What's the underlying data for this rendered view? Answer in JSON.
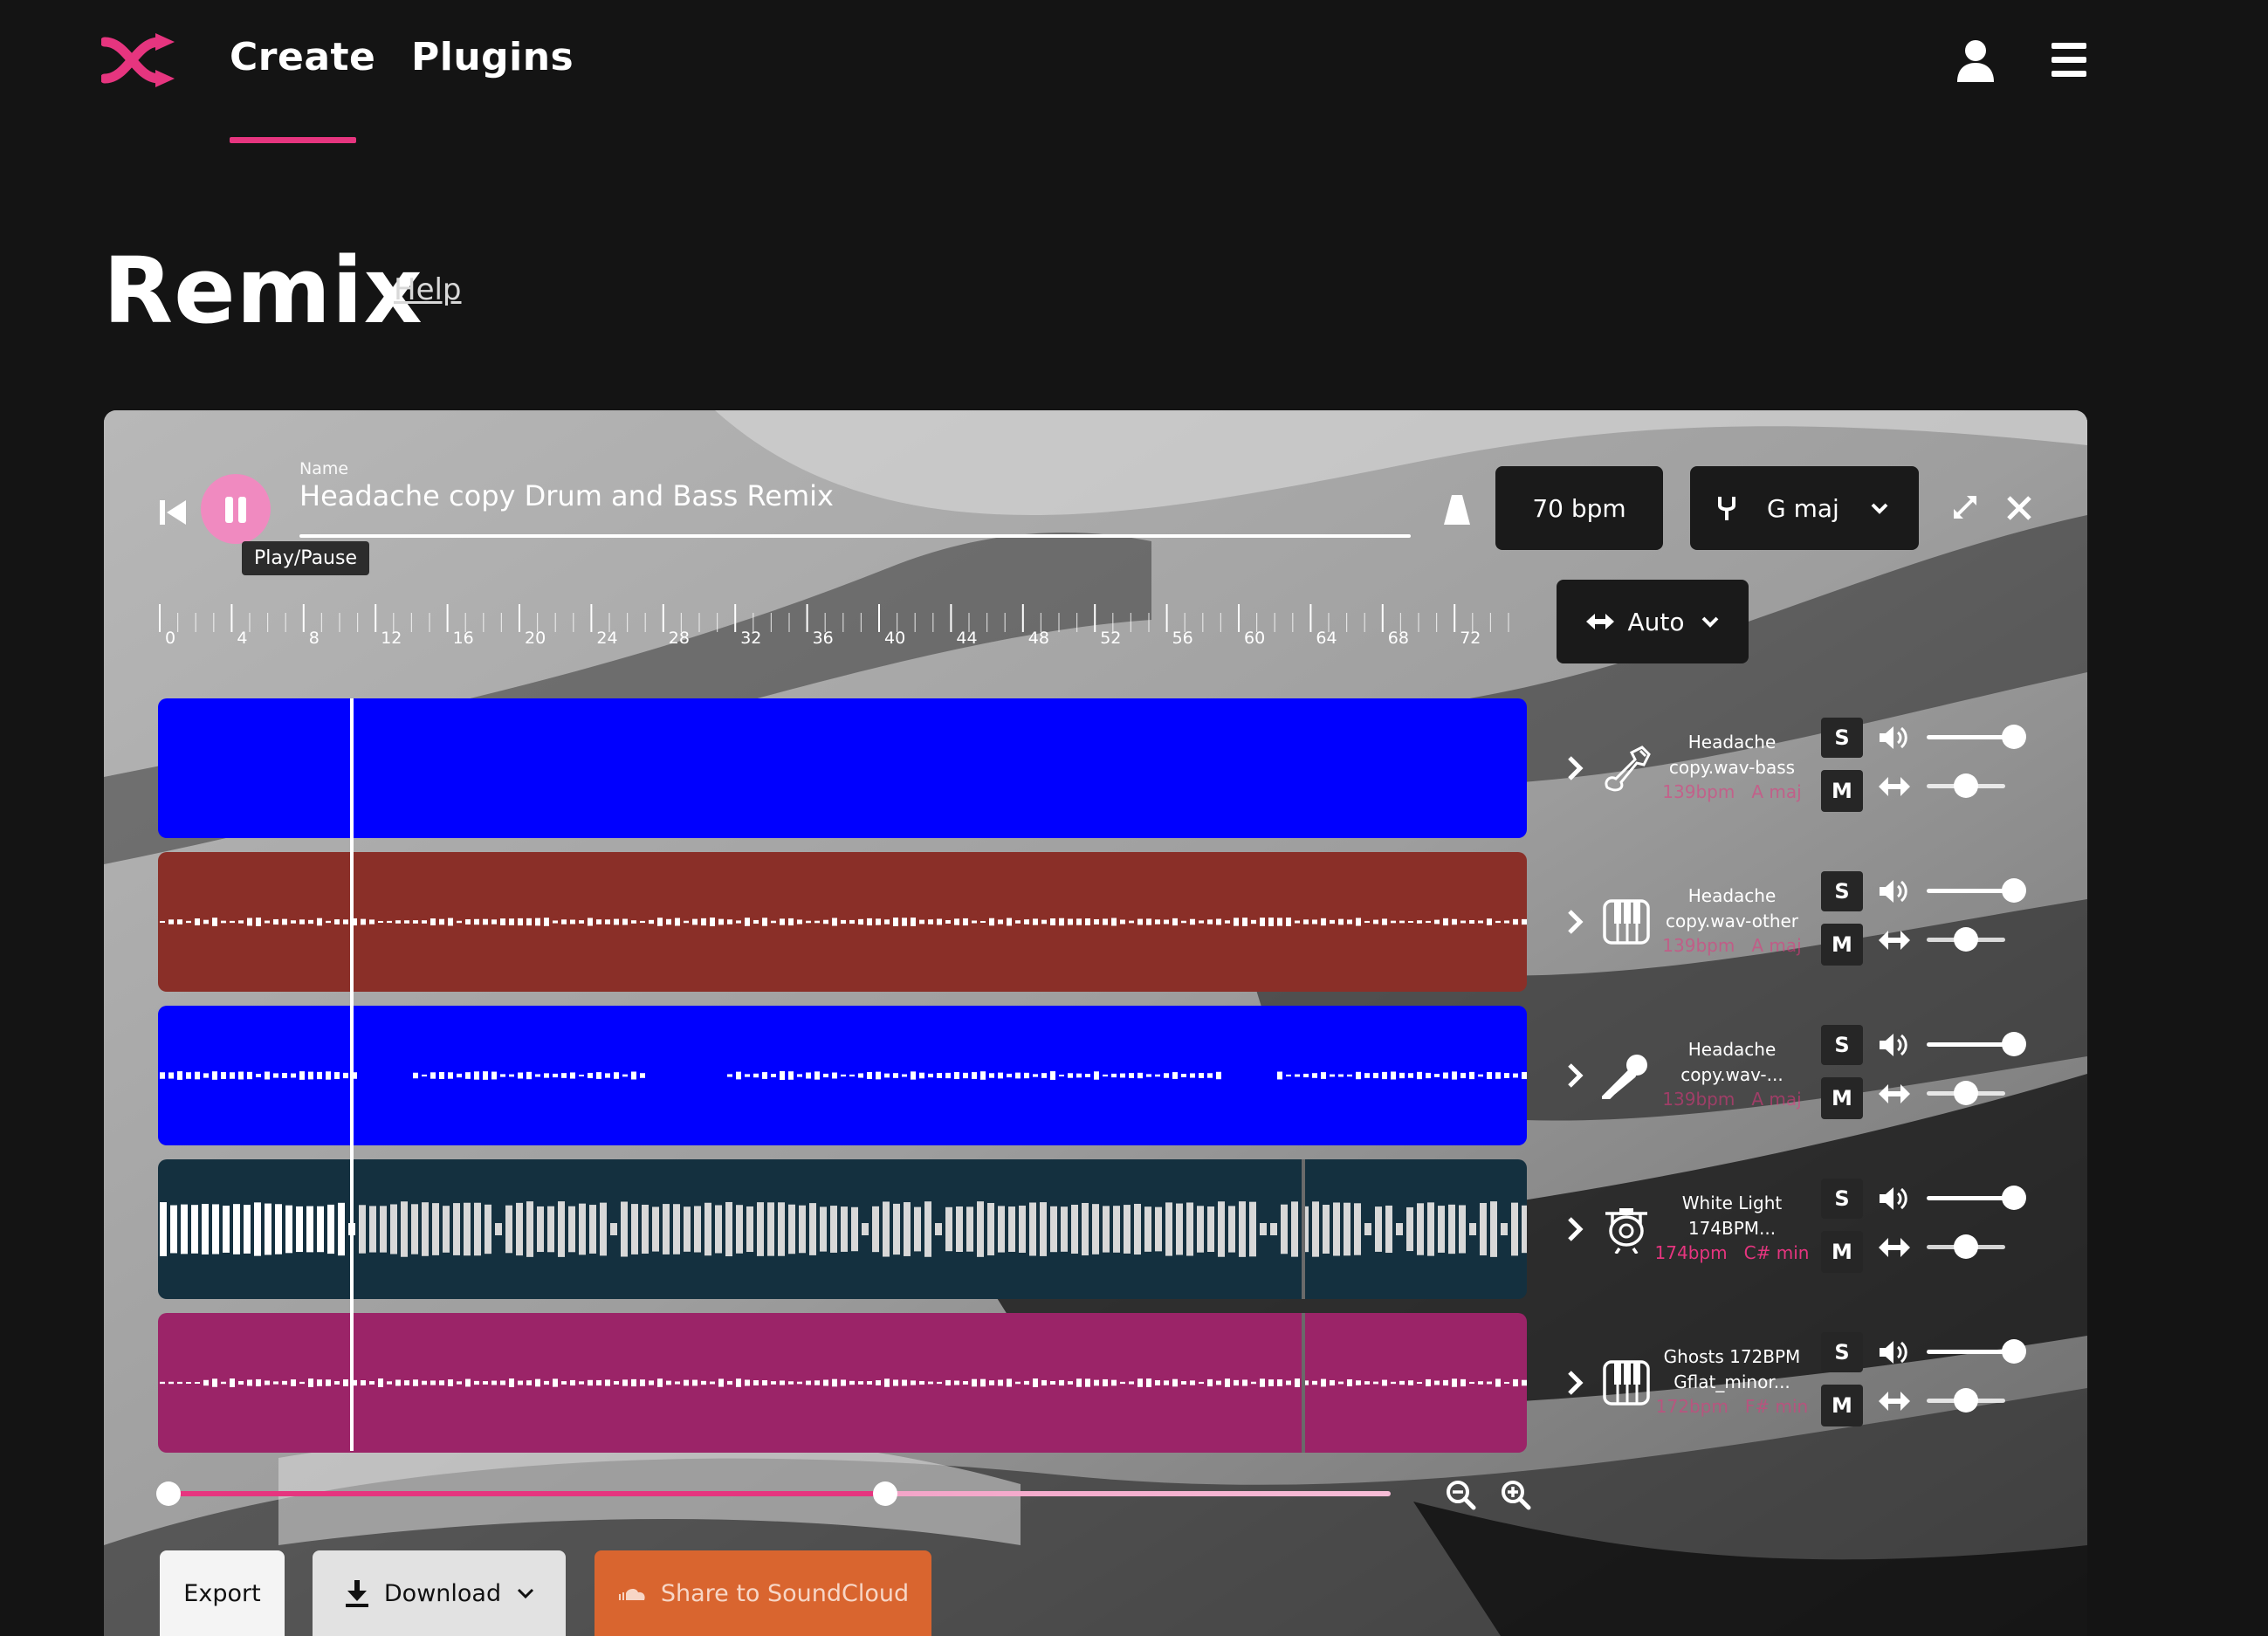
{
  "nav": {
    "create": "Create",
    "plugins": "Plugins"
  },
  "page": {
    "title": "Remix",
    "help": "Help"
  },
  "player": {
    "tooltip": "Play/Pause",
    "name_label": "Name",
    "name_value": "Headache copy Drum and Bass Remix",
    "bpm": "70 bpm",
    "key": "G maj",
    "mode": "Auto"
  },
  "ruler": [
    "0",
    "4",
    "8",
    "12",
    "16",
    "20",
    "24",
    "28",
    "32",
    "36",
    "40",
    "44",
    "48",
    "52",
    "56",
    "60",
    "64",
    "68",
    "72"
  ],
  "tracks": [
    {
      "name_line1": "Headache",
      "name_line2": "copy.wav-bass",
      "bpm": "139bpm",
      "key": "A maj",
      "instrument": "bass-guitar-icon",
      "color": "#0000ff",
      "volume": 1.0,
      "pan": 0.5
    },
    {
      "name_line1": "Headache",
      "name_line2": "copy.wav-other",
      "bpm": "139bpm",
      "key": "A maj",
      "instrument": "piano-icon",
      "color": "#8a2f28",
      "volume": 1.0,
      "pan": 0.5
    },
    {
      "name_line1": "Headache",
      "name_line2": "copy.wav-...",
      "bpm": "139bpm",
      "key": "A maj",
      "instrument": "microphone-icon",
      "color": "#0000ff",
      "volume": 1.0,
      "pan": 0.5
    },
    {
      "name_line1": "White Light",
      "name_line2": "174BPM...",
      "bpm": "174bpm",
      "key": "C# min",
      "instrument": "drum-kit-icon",
      "color": "#14303f",
      "volume": 1.0,
      "pan": 0.5
    },
    {
      "name_line1": "Ghosts 172BPM",
      "name_line2": "Gflat_minor...",
      "bpm": "172bpm",
      "key": "F# min",
      "instrument": "piano-icon",
      "color": "#9b2468",
      "volume": 1.0,
      "pan": 0.5
    }
  ],
  "controls": {
    "solo": "S",
    "mute": "M"
  },
  "zoom": {
    "start": 0.0,
    "end": 0.59
  },
  "actions": {
    "export": "Export",
    "download": "Download",
    "soundcloud": "Share to SoundCloud"
  },
  "colors": {
    "accent": "#e6357f",
    "play": "#f08ac0",
    "soundcloud": "#d9652f"
  }
}
